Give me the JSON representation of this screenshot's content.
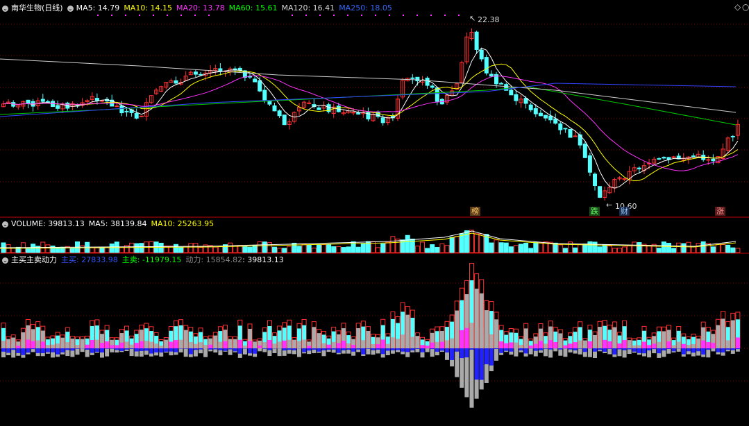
{
  "main": {
    "title": "南华生物(日线)",
    "ma": [
      {
        "label": "MA5: 14.79",
        "color": "#ffffff"
      },
      {
        "label": "MA10: 14.15",
        "color": "#ffff00"
      },
      {
        "label": "MA20: 13.78",
        "color": "#ff33ff"
      },
      {
        "label": "MA60: 15.61",
        "color": "#00ff00"
      },
      {
        "label": "MA120: 16.41",
        "color": "#d7d7d7"
      },
      {
        "label": "MA250: 18.05",
        "color": "#3366ff"
      }
    ],
    "high_label": "22.38",
    "low_label": "10.60",
    "markers": [
      {
        "text": "榜",
        "bg": "#5a3a1a",
        "color": "#ffcc66"
      },
      {
        "text": "跌",
        "bg": "#1a4a1a",
        "color": "#66ff66"
      },
      {
        "text": "财",
        "bg": "#1a2a4a",
        "color": "#99ccff"
      },
      {
        "text": "涨",
        "bg": "#5a1a1a",
        "color": "#ff9999"
      }
    ],
    "nav_icons": [
      "diamond-icon",
      "circle-icon"
    ]
  },
  "volume": {
    "label": "VOLUME: 39813.13",
    "ma5": "MA5: 38139.84",
    "ma10": "MA10: 25263.95"
  },
  "indicator": {
    "title": "主买主卖动力",
    "buy": "主买: 27833.98",
    "sell": "主卖: -11979.15",
    "power": "动力: 15854.82",
    "extra": ": 39813.13"
  },
  "colors": {
    "up": "#ff3232",
    "down": "#54ffff",
    "grid": "#8b0000",
    "buy": "#ff33ff",
    "sell": "#2222ff"
  }
}
